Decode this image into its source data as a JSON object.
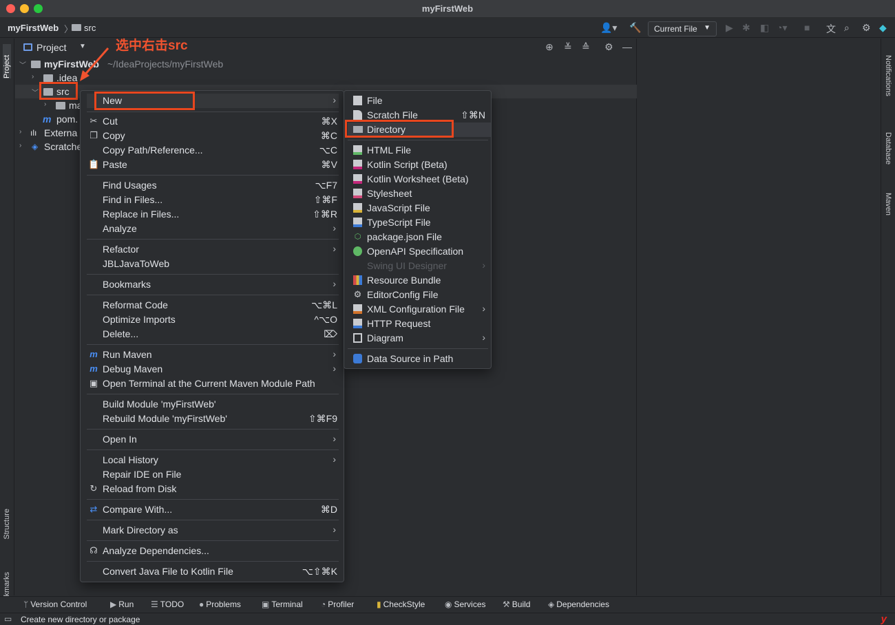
{
  "window": {
    "title": "myFirstWeb"
  },
  "navbar": {
    "crumbs": [
      "myFirstWeb",
      "src"
    ],
    "run_config": "Current File"
  },
  "stripes": {
    "left": [
      "Project",
      "Structure",
      "Bookmarks"
    ],
    "right": [
      "Notifications",
      "Database",
      "Maven"
    ]
  },
  "project_panel": {
    "title": "Project",
    "tree": [
      {
        "label": "myFirstWeb",
        "path": "~/IdeaProjects/myFirstWeb"
      },
      {
        "label": ".idea"
      },
      {
        "label": "src"
      },
      {
        "label": "ma"
      },
      {
        "label": "pom."
      },
      {
        "label": "Externa"
      },
      {
        "label": "Scratche"
      }
    ]
  },
  "annotation": {
    "text": "选中右击src"
  },
  "context_menu": {
    "items": [
      {
        "label": "New",
        "shortcut": "",
        "submenu": true
      },
      {
        "label": "Cut",
        "shortcut": "⌘X",
        "icon": "scissors-icon"
      },
      {
        "label": "Copy",
        "shortcut": "⌘C",
        "icon": "copy-icon"
      },
      {
        "label": "Copy Path/Reference...",
        "shortcut": "⌥C"
      },
      {
        "label": "Paste",
        "shortcut": "⌘V",
        "icon": "paste-icon"
      },
      {
        "label": "Find Usages",
        "shortcut": "⌥F7"
      },
      {
        "label": "Find in Files...",
        "shortcut": "⇧⌘F"
      },
      {
        "label": "Replace in Files...",
        "shortcut": "⇧⌘R"
      },
      {
        "label": "Analyze",
        "submenu": true
      },
      {
        "label": "Refactor",
        "submenu": true
      },
      {
        "label": "JBLJavaToWeb"
      },
      {
        "label": "Bookmarks",
        "submenu": true
      },
      {
        "label": "Reformat Code",
        "shortcut": "⌥⌘L"
      },
      {
        "label": "Optimize Imports",
        "shortcut": "^⌥O"
      },
      {
        "label": "Delete...",
        "shortcut": "⌦"
      },
      {
        "label": "Run Maven",
        "submenu": true
      },
      {
        "label": "Debug Maven",
        "submenu": true
      },
      {
        "label": "Open Terminal at the Current Maven Module Path"
      },
      {
        "label": "Build Module 'myFirstWeb'"
      },
      {
        "label": "Rebuild Module 'myFirstWeb'",
        "shortcut": "⇧⌘F9"
      },
      {
        "label": "Open In",
        "submenu": true
      },
      {
        "label": "Local History",
        "submenu": true
      },
      {
        "label": "Repair IDE on File"
      },
      {
        "label": "Reload from Disk"
      },
      {
        "label": "Compare With...",
        "shortcut": "⌘D"
      },
      {
        "label": "Mark Directory as",
        "submenu": true
      },
      {
        "label": "Analyze Dependencies..."
      },
      {
        "label": "Convert Java File to Kotlin File",
        "shortcut": "⌥⇧⌘K"
      }
    ]
  },
  "new_submenu": {
    "items": [
      {
        "label": "File"
      },
      {
        "label": "Scratch File",
        "shortcut": "⇧⌘N"
      },
      {
        "label": "Directory"
      },
      {
        "label": "HTML File"
      },
      {
        "label": "Kotlin Script (Beta)"
      },
      {
        "label": "Kotlin Worksheet (Beta)"
      },
      {
        "label": "Stylesheet"
      },
      {
        "label": "JavaScript File"
      },
      {
        "label": "TypeScript File"
      },
      {
        "label": "package.json File"
      },
      {
        "label": "OpenAPI Specification"
      },
      {
        "label": "Swing UI Designer",
        "disabled": true
      },
      {
        "label": "Resource Bundle"
      },
      {
        "label": "EditorConfig File"
      },
      {
        "label": "XML Configuration File"
      },
      {
        "label": "HTTP Request"
      },
      {
        "label": "Diagram"
      },
      {
        "label": "Data Source in Path"
      }
    ]
  },
  "toolwindows": [
    "Version Control",
    "Run",
    "TODO",
    "Problems",
    "Terminal",
    "Profiler",
    "CheckStyle",
    "Services",
    "Build",
    "Dependencies"
  ],
  "status": {
    "text": "Create new directory or package"
  }
}
